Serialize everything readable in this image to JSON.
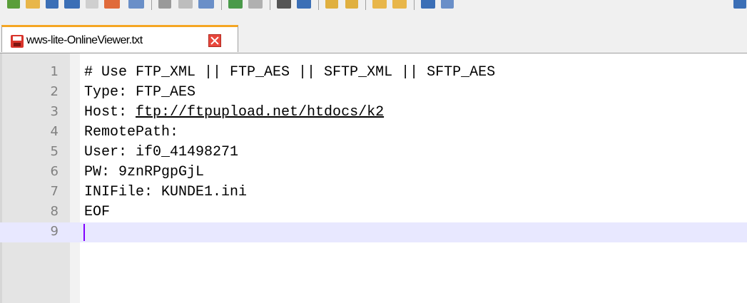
{
  "tab": {
    "filename": "wws-lite-OnlineViewer.txt"
  },
  "editor": {
    "lines": [
      {
        "number": "1",
        "text": "# Use FTP_XML || FTP_AES || SFTP_XML || SFTP_AES"
      },
      {
        "number": "2",
        "text": "Type: FTP_AES"
      },
      {
        "number": "3",
        "prefix": "Host: ",
        "link": "ftp://ftpupload.net/htdocs/k2"
      },
      {
        "number": "4",
        "text": "RemotePath:"
      },
      {
        "number": "5",
        "text": "User: if0_41498271"
      },
      {
        "number": "6",
        "text": "PW: 9znRPgpGjL"
      },
      {
        "number": "7",
        "text": "INIFile: KUNDE1.ini"
      },
      {
        "number": "8",
        "text": "EOF"
      },
      {
        "number": "9",
        "text": ""
      }
    ],
    "current_line": "9"
  },
  "colors": {
    "current_line_bg": "#e8e8ff",
    "caret": "#8000ff",
    "line_number": "#808080",
    "tab_accent": "#f5a623"
  }
}
